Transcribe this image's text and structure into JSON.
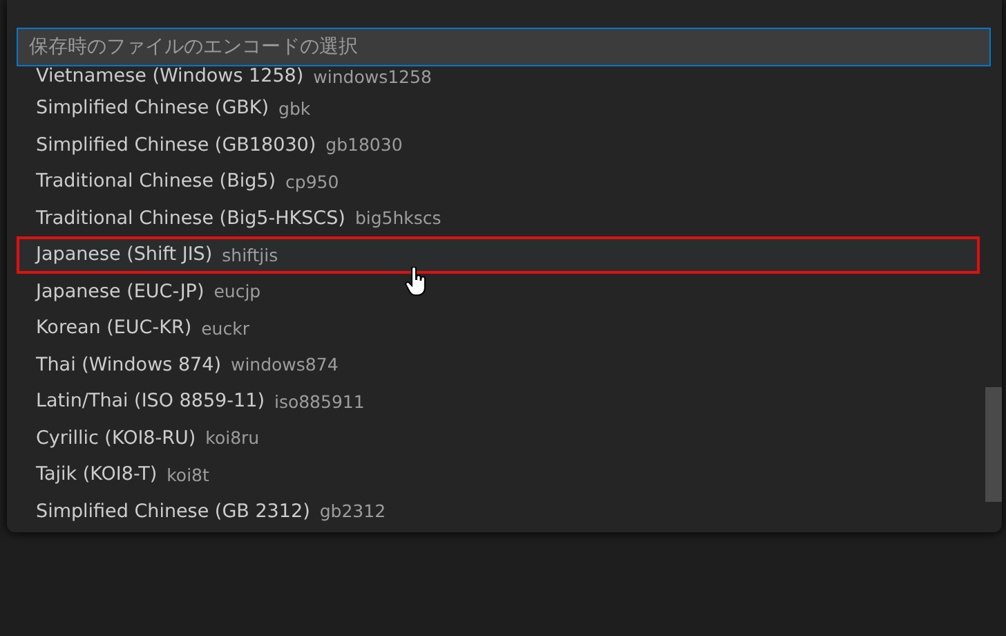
{
  "quick_pick": {
    "placeholder": "保存時のファイルのエンコードの選択",
    "items": [
      {
        "label": "Vietnamese (Windows 1258)",
        "description": "windows1258",
        "selected": false
      },
      {
        "label": "Simplified Chinese (GBK)",
        "description": "gbk",
        "selected": false
      },
      {
        "label": "Simplified Chinese (GB18030)",
        "description": "gb18030",
        "selected": false
      },
      {
        "label": "Traditional Chinese (Big5)",
        "description": "cp950",
        "selected": false
      },
      {
        "label": "Traditional Chinese (Big5-HKSCS)",
        "description": "big5hkscs",
        "selected": false
      },
      {
        "label": "Japanese (Shift JIS)",
        "description": "shiftjis",
        "selected": true
      },
      {
        "label": "Japanese (EUC-JP)",
        "description": "eucjp",
        "selected": false
      },
      {
        "label": "Korean (EUC-KR)",
        "description": "euckr",
        "selected": false
      },
      {
        "label": "Thai (Windows 874)",
        "description": "windows874",
        "selected": false
      },
      {
        "label": "Latin/Thai (ISO 8859-11)",
        "description": "iso885911",
        "selected": false
      },
      {
        "label": "Cyrillic (KOI8-RU)",
        "description": "koi8ru",
        "selected": false
      },
      {
        "label": "Tajik (KOI8-T)",
        "description": "koi8t",
        "selected": false
      },
      {
        "label": "Simplified Chinese (GB 2312)",
        "description": "gb2312",
        "selected": false
      }
    ]
  }
}
